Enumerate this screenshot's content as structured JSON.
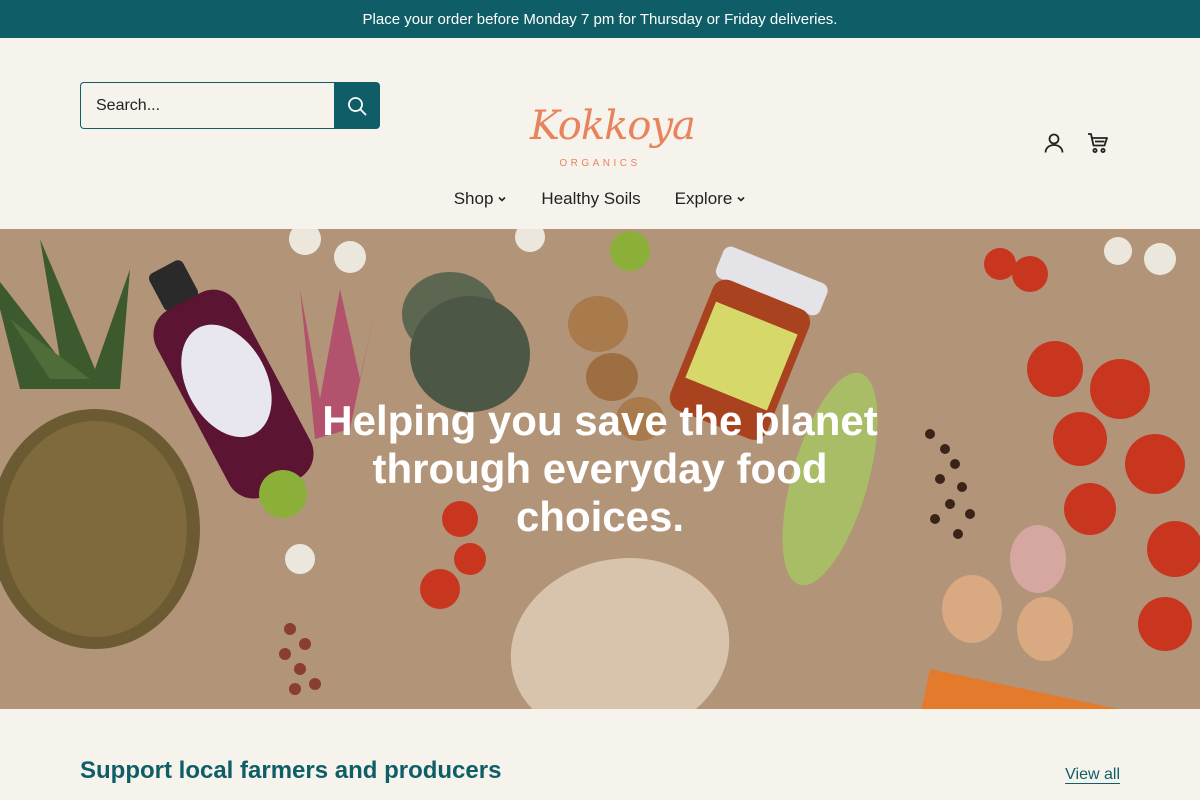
{
  "announcement": {
    "text": "Place your order before Monday 7 pm for Thursday or Friday deliveries."
  },
  "header": {
    "search": {
      "placeholder": "Search..."
    },
    "logo": {
      "wordmark": "Kokkoya",
      "tagline": "ORGANICS"
    },
    "icons": [
      "account-icon",
      "cart-icon"
    ]
  },
  "nav": {
    "items": [
      {
        "label": "Shop",
        "has_dropdown": true
      },
      {
        "label": "Healthy Soils",
        "has_dropdown": false
      },
      {
        "label": "Explore",
        "has_dropdown": true
      }
    ]
  },
  "hero": {
    "title": "Helping you save the planet through everyday food choices."
  },
  "featured": {
    "title": "Support local farmers and producers",
    "view_all": "View all"
  },
  "colors": {
    "brand": "#0f5e67",
    "logo": "#e8845d",
    "background": "#f6f3ec"
  }
}
